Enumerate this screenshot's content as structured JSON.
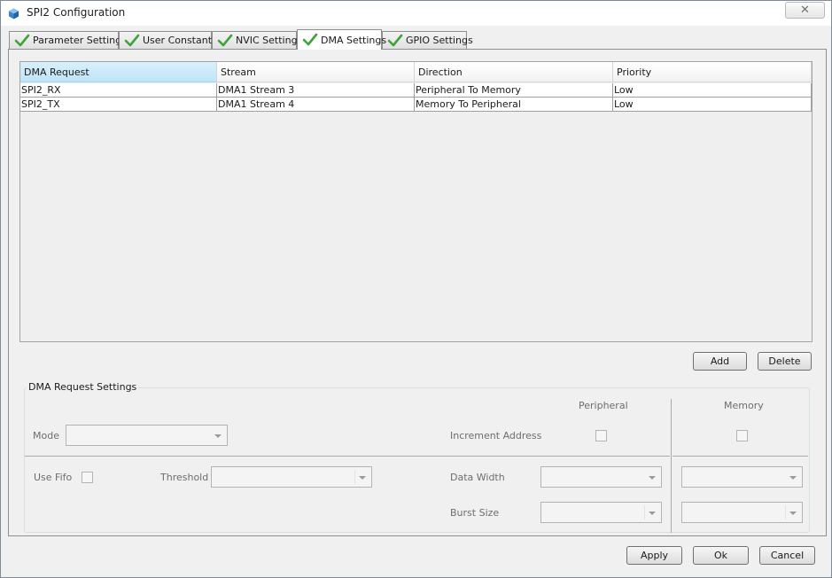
{
  "window": {
    "title": "SPI2 Configuration"
  },
  "tabs": [
    {
      "label": "Parameter Settings"
    },
    {
      "label": "User Constants"
    },
    {
      "label": "NVIC Settings"
    },
    {
      "label": "DMA Settings"
    },
    {
      "label": "GPIO Settings"
    }
  ],
  "active_tab": "DMA Settings",
  "dma_table": {
    "columns": [
      "DMA Request",
      "Stream",
      "Direction",
      "Priority"
    ],
    "rows": [
      [
        "SPI2_RX",
        "DMA1 Stream 3",
        "Peripheral To Memory",
        "Low"
      ],
      [
        "SPI2_TX",
        "DMA1 Stream 4",
        "Memory To Peripheral",
        "Low"
      ]
    ]
  },
  "table_buttons": {
    "add": "Add",
    "delete": "Delete"
  },
  "request_settings": {
    "title": "DMA Request Settings",
    "peripheral_header": "Peripheral",
    "memory_header": "Memory",
    "mode_label": "Mode",
    "mode_value": "",
    "increment_address_label": "Increment Address",
    "use_fifo_label": "Use Fifo",
    "threshold_label": "Threshold",
    "threshold_value": "",
    "data_width_label": "Data Width",
    "burst_size_label": "Burst Size",
    "peripheral_data_width": "",
    "memory_data_width": "",
    "peripheral_burst_size": "",
    "memory_burst_size": ""
  },
  "footer_buttons": {
    "apply": "Apply",
    "ok": "Ok",
    "cancel": "Cancel"
  },
  "colors": {
    "check_green": "#3fa33a",
    "sorted_header": "#bfe4f7",
    "window_bg": "#f0f0f0"
  }
}
